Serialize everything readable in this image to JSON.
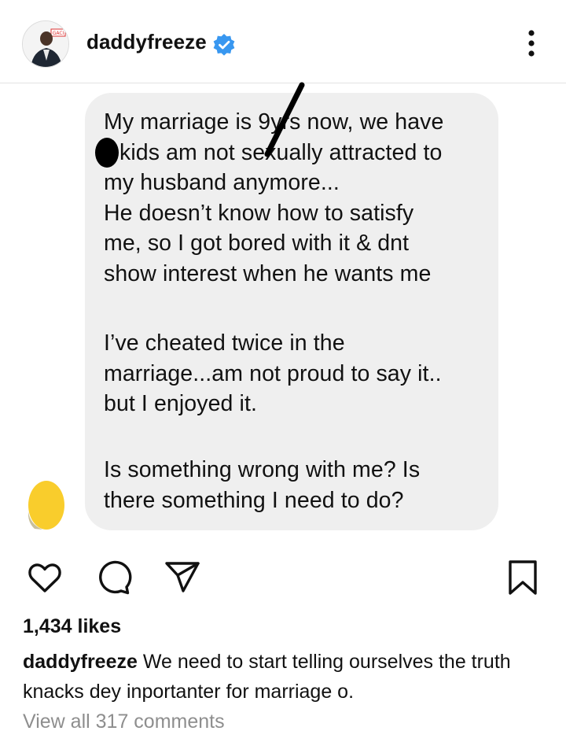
{
  "header": {
    "username": "daddyfreeze",
    "verified": true,
    "avatar_icon": "profile-photo-icon",
    "more_icon": "more-vertical-icon"
  },
  "message": {
    "paragraph1": [
      "My marriage is 9yrs now, we have",
      "kids am not sexually attracted to",
      "my husband anymore...",
      "He doesn’t know how to satisfy",
      "me, so I got bored with it & dnt",
      "show interest when he wants me"
    ],
    "paragraph2": [
      "I’ve cheated twice in the",
      "marriage...am not proud to say it..",
      "but I enjoyed it."
    ],
    "paragraph3": [
      "Is something wrong with me? Is",
      "there something I need to do?"
    ]
  },
  "actions": {
    "like_icon": "heart-icon",
    "comment_icon": "comment-icon",
    "share_icon": "send-icon",
    "save_icon": "bookmark-icon"
  },
  "likes": "1,434 likes",
  "caption": {
    "username": "daddyfreeze",
    "text": "We need to start telling ourselves the truth knacks dey inportanter for marriage o."
  },
  "comments_link": "View all 317 comments",
  "colors": {
    "bubble": "#efefef",
    "verified_blue": "#3897f0",
    "muted_text": "#8e8e8e",
    "sender_avatar_yellow": "#f9cd2c"
  }
}
